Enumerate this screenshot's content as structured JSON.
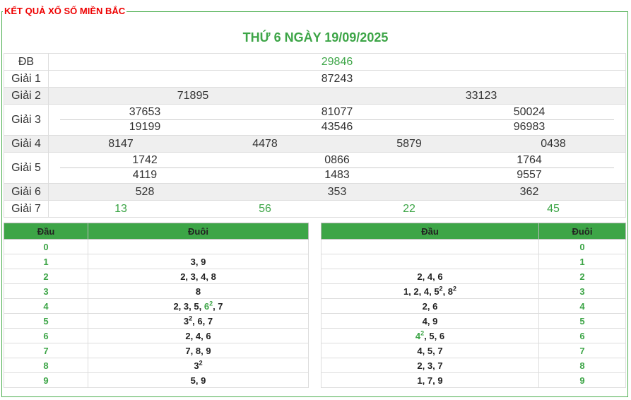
{
  "header": {
    "title": "KẾT QUẢ XỔ SỐ MIỀN BẮC",
    "date": "THỨ 6 NGÀY 19/09/2025"
  },
  "results": {
    "db": {
      "label": "ĐB",
      "values": [
        "29846"
      ]
    },
    "g1": {
      "label": "Giải 1",
      "values": [
        "87243"
      ]
    },
    "g2": {
      "label": "Giải 2",
      "values": [
        "71895",
        "33123"
      ]
    },
    "g3": {
      "label": "Giải 3",
      "rows": [
        [
          "37653",
          "81077",
          "50024"
        ],
        [
          "19199",
          "43546",
          "96983"
        ]
      ]
    },
    "g4": {
      "label": "Giải 4",
      "values": [
        "8147",
        "4478",
        "5879",
        "0438"
      ]
    },
    "g5": {
      "label": "Giải 5",
      "rows": [
        [
          "1742",
          "0866",
          "1764"
        ],
        [
          "4119",
          "1483",
          "9557"
        ]
      ]
    },
    "g6": {
      "label": "Giải 6",
      "values": [
        "528",
        "353",
        "362"
      ]
    },
    "g7": {
      "label": "Giải 7",
      "values": [
        "13",
        "56",
        "22",
        "45"
      ]
    }
  },
  "loto_head": {
    "col_head": "Đầu",
    "col_tail": "Đuôi",
    "rows": [
      {
        "head": "0",
        "parts": []
      },
      {
        "head": "1",
        "parts": [
          {
            "t": "3, 9"
          }
        ]
      },
      {
        "head": "2",
        "parts": [
          {
            "t": "2, 3, 4, 8"
          }
        ]
      },
      {
        "head": "3",
        "parts": [
          {
            "t": "8"
          }
        ]
      },
      {
        "head": "4",
        "parts": [
          {
            "t": "2, 3, 5, "
          },
          {
            "t": "6",
            "sup": "2",
            "green": true
          },
          {
            "t": ", 7"
          }
        ]
      },
      {
        "head": "5",
        "parts": [
          {
            "t": "3",
            "sup": "2"
          },
          {
            "t": ", 6, 7"
          }
        ]
      },
      {
        "head": "6",
        "parts": [
          {
            "t": "2, 4, 6"
          }
        ]
      },
      {
        "head": "7",
        "parts": [
          {
            "t": "7, 8, 9"
          }
        ]
      },
      {
        "head": "8",
        "parts": [
          {
            "t": "3",
            "sup": "2"
          }
        ]
      },
      {
        "head": "9",
        "parts": [
          {
            "t": "5, 9"
          }
        ]
      }
    ]
  },
  "loto_tail": {
    "col_head": "Đầu",
    "col_tail": "Đuôi",
    "rows": [
      {
        "tail": "0",
        "parts": []
      },
      {
        "tail": "1",
        "parts": []
      },
      {
        "tail": "2",
        "parts": [
          {
            "t": "2, 4, 6"
          }
        ]
      },
      {
        "tail": "3",
        "parts": [
          {
            "t": "1, 2, 4, "
          },
          {
            "t": "5",
            "sup": "2"
          },
          {
            "t": ", "
          },
          {
            "t": "8",
            "sup": "2"
          }
        ]
      },
      {
        "tail": "4",
        "parts": [
          {
            "t": "2, 6"
          }
        ]
      },
      {
        "tail": "5",
        "parts": [
          {
            "t": "4, 9"
          }
        ]
      },
      {
        "tail": "6",
        "parts": [
          {
            "t": "4",
            "sup": "2",
            "green": true
          },
          {
            "t": ", 5, 6"
          }
        ]
      },
      {
        "tail": "7",
        "parts": [
          {
            "t": "4, 5, 7"
          }
        ]
      },
      {
        "tail": "8",
        "parts": [
          {
            "t": "2, 3, 7"
          }
        ]
      },
      {
        "tail": "9",
        "parts": [
          {
            "t": "1, 7, 9"
          }
        ]
      }
    ]
  },
  "colors": {
    "green": "#3da547",
    "red": "#e00000",
    "header_bg": "#3da547",
    "alt_row": "#efefef"
  }
}
